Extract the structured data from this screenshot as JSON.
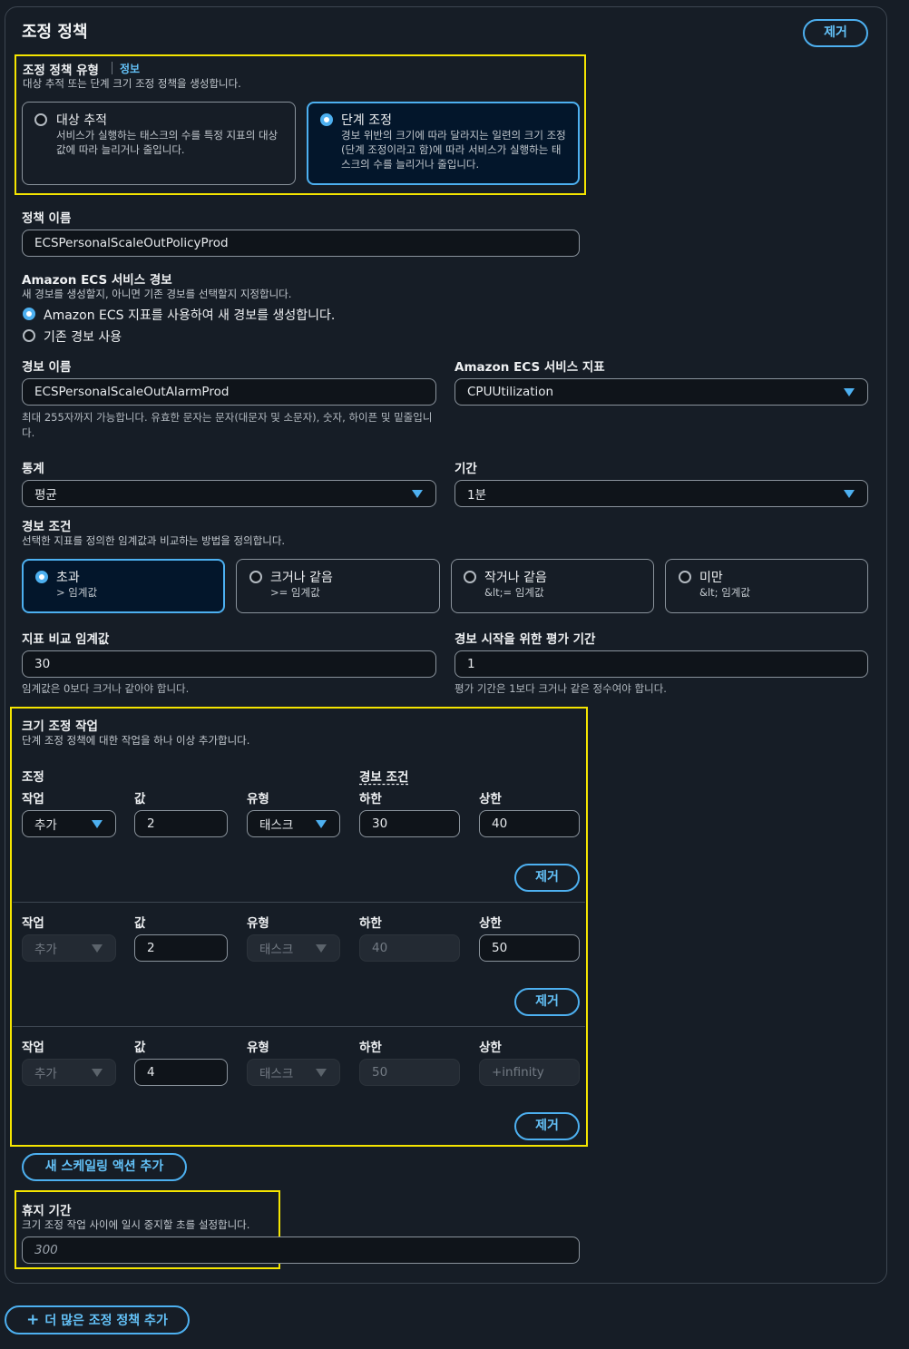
{
  "panel": {
    "title": "조정 정책",
    "remove_label": "제거"
  },
  "policy_type": {
    "label": "조정 정책 유형",
    "info_link": "정보",
    "description": "대상 추적 또는 단계 크기 조정 정책을 생성합니다.",
    "options": [
      {
        "title": "대상 추적",
        "description": "서비스가 실행하는 태스크의 수를 특정 지표의 대상 값에 따라 늘리거나 줄입니다.",
        "selected": false
      },
      {
        "title": "단계 조정",
        "description": "경보 위반의 크기에 따라 달라지는 일련의 크기 조정(단계 조정이라고 함)에 따라 서비스가 실행하는 태스크의 수를 늘리거나 줄입니다.",
        "selected": true
      }
    ]
  },
  "policy_name": {
    "label": "정책 이름",
    "value": "ECSPersonalScaleOutPolicyProd"
  },
  "alarm_choice": {
    "label": "Amazon ECS 서비스 경보",
    "description": "새 경보를 생성할지, 아니면 기존 경보를 선택할지 지정합니다.",
    "options": [
      {
        "label": "Amazon ECS 지표를 사용하여 새 경보를 생성합니다.",
        "selected": true
      },
      {
        "label": "기존 경보 사용",
        "selected": false
      }
    ]
  },
  "alarm_name": {
    "label": "경보 이름",
    "value": "ECSPersonalScaleOutAlarmProd",
    "hint": "최대 255자까지 가능합니다. 유효한 문자는 문자(대문자 및 소문자), 숫자, 하이픈 및 밑줄입니다."
  },
  "metric": {
    "label": "Amazon ECS 서비스 지표",
    "value": "CPUUtilization"
  },
  "statistic": {
    "label": "통계",
    "value": "평균"
  },
  "period": {
    "label": "기간",
    "value": "1분"
  },
  "alarm_condition": {
    "label": "경보 조건",
    "description": "선택한 지표를 정의한 임계값과 비교하는 방법을 정의합니다.",
    "options": [
      {
        "title": "초과",
        "sub": "> 임계값",
        "selected": true
      },
      {
        "title": "크거나 같음",
        "sub": ">= 임계값",
        "selected": false
      },
      {
        "title": "작거나 같음",
        "sub": "&lt;= 임계값",
        "selected": false
      },
      {
        "title": "미만",
        "sub": "&lt; 임계값",
        "selected": false
      }
    ]
  },
  "threshold": {
    "label": "지표 비교 임계값",
    "value": "30",
    "hint": "임계값은 0보다 크거나 같아야 합니다."
  },
  "evaluation": {
    "label": "경보 시작을 위한 평가 기간",
    "value": "1",
    "hint": "평가 기간은 1보다 크거나 같은 정수여야 합니다."
  },
  "scaling_actions": {
    "label": "크기 조정 작업",
    "description": "단계 조정 정책에 대한 작업을 하나 이상 추가합니다.",
    "group_adjust": "조정",
    "group_alarm": "경보 조건",
    "headers": {
      "action": "작업",
      "value": "값",
      "type": "유형",
      "lower": "하한",
      "upper": "상한"
    },
    "remove_label": "제거",
    "rows": [
      {
        "action": "추가",
        "value": "2",
        "type": "태스크",
        "lower": "30",
        "upper": "40"
      },
      {
        "action": "추가",
        "value": "2",
        "type": "태스크",
        "lower": "40",
        "upper": "50"
      },
      {
        "action": "추가",
        "value": "4",
        "type": "태스크",
        "lower": "50",
        "upper_placeholder": "+infinity"
      }
    ],
    "add_label": "새 스케일링 액션 추가"
  },
  "cooldown": {
    "label": "휴지 기간",
    "description": "크기 조정 작업 사이에 일시 중지할 초를 설정합니다.",
    "placeholder": "300"
  },
  "add_policy": {
    "label": "더 많은 조정 정책 추가"
  },
  "colors": {
    "accent": "#4db0f0",
    "highlight": "#f5e500",
    "background": "#161d26"
  }
}
